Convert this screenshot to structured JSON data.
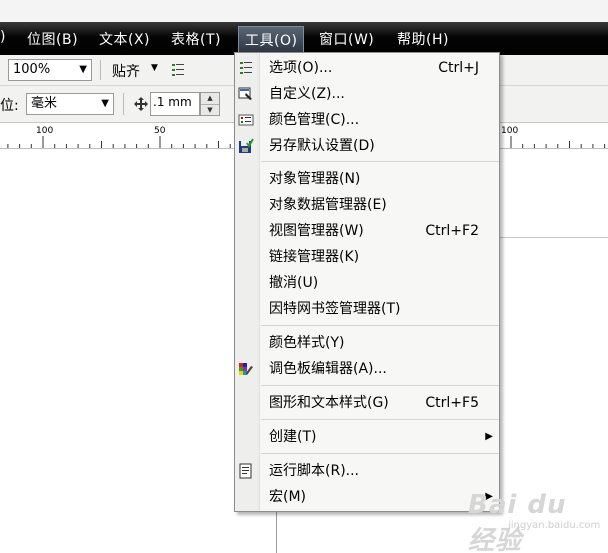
{
  "menubar": {
    "partial_left": ")",
    "items": [
      {
        "label": "位图(B)"
      },
      {
        "label": "文本(X)"
      },
      {
        "label": "表格(T)"
      },
      {
        "label": "工具(O)"
      },
      {
        "label": "窗口(W)"
      },
      {
        "label": "帮助(H)"
      }
    ],
    "active_item": "工具(O)"
  },
  "toolbar1": {
    "zoom_value": "100%",
    "snap_label": "贴齐"
  },
  "toolbar2": {
    "unit_label": "位:",
    "unit_value": "毫米",
    "nudge_value": ".1 mm"
  },
  "ruler": {
    "labels": [
      "100",
      "50",
      "100"
    ]
  },
  "tools_menu": {
    "items": [
      {
        "label": "选项(O)...",
        "shortcut": "Ctrl+J",
        "icon": "options-icon"
      },
      {
        "label": "自定义(Z)...",
        "shortcut": "",
        "icon": "customize-icon"
      },
      {
        "label": "颜色管理(C)...",
        "shortcut": "",
        "icon": "color-management-icon"
      },
      {
        "label": "另存默认设置(D)",
        "shortcut": "",
        "icon": "save-defaults-icon"
      },
      {
        "label": "对象管理器(N)",
        "shortcut": "",
        "icon": ""
      },
      {
        "label": "对象数据管理器(E)",
        "shortcut": "",
        "icon": ""
      },
      {
        "label": "视图管理器(W)",
        "shortcut": "Ctrl+F2",
        "icon": ""
      },
      {
        "label": "链接管理器(K)",
        "shortcut": "",
        "icon": ""
      },
      {
        "label": "撤消(U)",
        "shortcut": "",
        "icon": ""
      },
      {
        "label": "因特网书签管理器(T)",
        "shortcut": "",
        "icon": ""
      },
      {
        "label": "颜色样式(Y)",
        "shortcut": "",
        "icon": ""
      },
      {
        "label": "调色板编辑器(A)...",
        "shortcut": "",
        "icon": "palette-editor-icon"
      },
      {
        "label": "图形和文本样式(G)",
        "shortcut": "Ctrl+F5",
        "icon": ""
      },
      {
        "label": "创建(T)",
        "shortcut": "",
        "icon": "",
        "submenu": true
      },
      {
        "label": "运行脚本(R)...",
        "shortcut": "",
        "icon": "run-script-icon"
      },
      {
        "label": "宏(M)",
        "shortcut": "",
        "icon": "",
        "submenu": true
      }
    ]
  },
  "watermark": {
    "text": "Bai du 经验",
    "sub": "jingyan.baidu.com"
  }
}
